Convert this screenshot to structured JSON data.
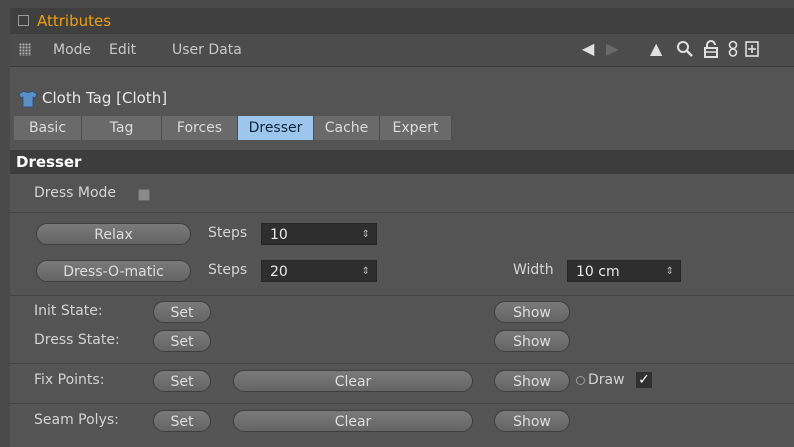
{
  "window": {
    "title": "Attributes"
  },
  "menu": {
    "items": [
      "Mode",
      "Edit",
      "User Data"
    ]
  },
  "nav_icons": [
    "back-arrow-icon",
    "forward-arrow-icon",
    "up-arrow-icon",
    "search-icon",
    "lock-icon",
    "link-icon",
    "new-panel-icon"
  ],
  "object": {
    "name": "Cloth Tag [Cloth]",
    "icon": "cloth-shirt-icon"
  },
  "tabs": [
    {
      "label": "Basic",
      "active": false
    },
    {
      "label": "Tag",
      "active": false
    },
    {
      "label": "Forces",
      "active": false
    },
    {
      "label": "Dresser",
      "active": true
    },
    {
      "label": "Cache",
      "active": false
    },
    {
      "label": "Expert",
      "active": false
    }
  ],
  "section": {
    "title": "Dresser"
  },
  "dresser": {
    "dress_mode_label": "Dress Mode",
    "relax_button": "Relax",
    "relax_steps_label": "Steps",
    "relax_steps_value": "10",
    "dressomatic_button": "Dress-O-matic",
    "dressomatic_steps_label": "Steps",
    "dressomatic_steps_value": "20",
    "width_label": "Width",
    "width_value": "10 cm",
    "init_state_label": "Init State:",
    "init_set": "Set",
    "init_show": "Show",
    "dress_state_label": "Dress State:",
    "dress_set": "Set",
    "dress_show": "Show",
    "fix_points_label": "Fix Points:",
    "fix_set": "Set",
    "fix_clear": "Clear",
    "fix_show": "Show",
    "fix_draw_label": "Draw",
    "fix_draw_checked": "✓",
    "seam_polys_label": "Seam Polys:",
    "seam_set": "Set",
    "seam_clear": "Clear",
    "seam_show": "Show"
  },
  "colors": {
    "title_accent": "#f0a010",
    "active_tab": "#9cc6ec",
    "panel_bg": "#545454"
  }
}
